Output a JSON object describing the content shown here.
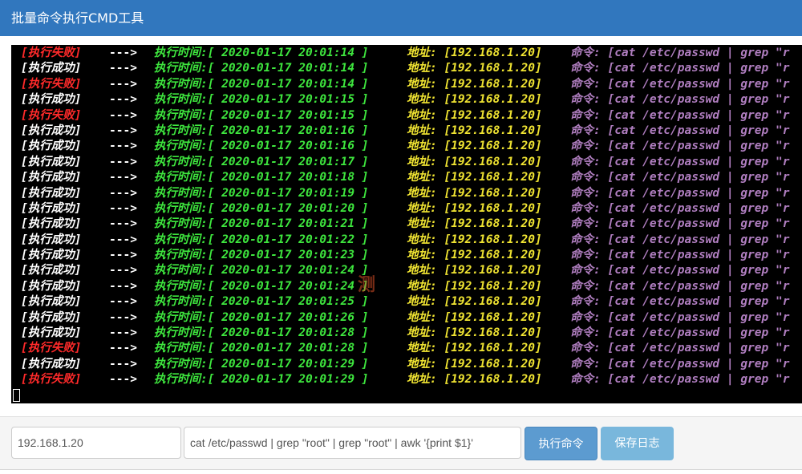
{
  "app": {
    "title": "批量命令执行CMD工具"
  },
  "colors": {
    "titlebar": "#3177be",
    "success": "#ffffff",
    "failure": "#ff2a2a",
    "time": "#3ee63e",
    "address": "#f0e432",
    "command": "#b07ec0"
  },
  "watermark": "测",
  "console": {
    "lines": [
      {
        "status": "[执行失败]",
        "ok": false,
        "arrow": "--->",
        "time": "执行时间:[ 2020-01-17 20:01:14 ]",
        "addr": "地址: [192.168.1.20]",
        "cmd": "命令: [cat /etc/passwd | grep \"r"
      },
      {
        "status": "[执行成功]",
        "ok": true,
        "arrow": "--->",
        "time": "执行时间:[ 2020-01-17 20:01:14 ]",
        "addr": "地址: [192.168.1.20]",
        "cmd": "命令: [cat /etc/passwd | grep \"r"
      },
      {
        "status": "[执行失败]",
        "ok": false,
        "arrow": "--->",
        "time": "执行时间:[ 2020-01-17 20:01:14 ]",
        "addr": "地址: [192.168.1.20]",
        "cmd": "命令: [cat /etc/passwd | grep \"r"
      },
      {
        "status": "[执行成功]",
        "ok": true,
        "arrow": "--->",
        "time": "执行时间:[ 2020-01-17 20:01:15 ]",
        "addr": "地址: [192.168.1.20]",
        "cmd": "命令: [cat /etc/passwd | grep \"r"
      },
      {
        "status": "[执行失败]",
        "ok": false,
        "arrow": "--->",
        "time": "执行时间:[ 2020-01-17 20:01:15 ]",
        "addr": "地址: [192.168.1.20]",
        "cmd": "命令: [cat /etc/passwd | grep \"r"
      },
      {
        "status": "[执行成功]",
        "ok": true,
        "arrow": "--->",
        "time": "执行时间:[ 2020-01-17 20:01:16 ]",
        "addr": "地址: [192.168.1.20]",
        "cmd": "命令: [cat /etc/passwd | grep \"r"
      },
      {
        "status": "[执行成功]",
        "ok": true,
        "arrow": "--->",
        "time": "执行时间:[ 2020-01-17 20:01:16 ]",
        "addr": "地址: [192.168.1.20]",
        "cmd": "命令: [cat /etc/passwd | grep \"r"
      },
      {
        "status": "[执行成功]",
        "ok": true,
        "arrow": "--->",
        "time": "执行时间:[ 2020-01-17 20:01:17 ]",
        "addr": "地址: [192.168.1.20]",
        "cmd": "命令: [cat /etc/passwd | grep \"r"
      },
      {
        "status": "[执行成功]",
        "ok": true,
        "arrow": "--->",
        "time": "执行时间:[ 2020-01-17 20:01:18 ]",
        "addr": "地址: [192.168.1.20]",
        "cmd": "命令: [cat /etc/passwd | grep \"r"
      },
      {
        "status": "[执行成功]",
        "ok": true,
        "arrow": "--->",
        "time": "执行时间:[ 2020-01-17 20:01:19 ]",
        "addr": "地址: [192.168.1.20]",
        "cmd": "命令: [cat /etc/passwd | grep \"r"
      },
      {
        "status": "[执行成功]",
        "ok": true,
        "arrow": "--->",
        "time": "执行时间:[ 2020-01-17 20:01:20 ]",
        "addr": "地址: [192.168.1.20]",
        "cmd": "命令: [cat /etc/passwd | grep \"r"
      },
      {
        "status": "[执行成功]",
        "ok": true,
        "arrow": "--->",
        "time": "执行时间:[ 2020-01-17 20:01:21 ]",
        "addr": "地址: [192.168.1.20]",
        "cmd": "命令: [cat /etc/passwd | grep \"r"
      },
      {
        "status": "[执行成功]",
        "ok": true,
        "arrow": "--->",
        "time": "执行时间:[ 2020-01-17 20:01:22 ]",
        "addr": "地址: [192.168.1.20]",
        "cmd": "命令: [cat /etc/passwd | grep \"r"
      },
      {
        "status": "[执行成功]",
        "ok": true,
        "arrow": "--->",
        "time": "执行时间:[ 2020-01-17 20:01:23 ]",
        "addr": "地址: [192.168.1.20]",
        "cmd": "命令: [cat /etc/passwd | grep \"r"
      },
      {
        "status": "[执行成功]",
        "ok": true,
        "arrow": "--->",
        "time": "执行时间:[ 2020-01-17 20:01:24 ]",
        "addr": "地址: [192.168.1.20]",
        "cmd": "命令: [cat /etc/passwd | grep \"r"
      },
      {
        "status": "[执行成功]",
        "ok": true,
        "arrow": "--->",
        "time": "执行时间:[ 2020-01-17 20:01:24 ]",
        "addr": "地址: [192.168.1.20]",
        "cmd": "命令: [cat /etc/passwd | grep \"r"
      },
      {
        "status": "[执行成功]",
        "ok": true,
        "arrow": "--->",
        "time": "执行时间:[ 2020-01-17 20:01:25 ]",
        "addr": "地址: [192.168.1.20]",
        "cmd": "命令: [cat /etc/passwd | grep \"r"
      },
      {
        "status": "[执行成功]",
        "ok": true,
        "arrow": "--->",
        "time": "执行时间:[ 2020-01-17 20:01:26 ]",
        "addr": "地址: [192.168.1.20]",
        "cmd": "命令: [cat /etc/passwd | grep \"r"
      },
      {
        "status": "[执行成功]",
        "ok": true,
        "arrow": "--->",
        "time": "执行时间:[ 2020-01-17 20:01:28 ]",
        "addr": "地址: [192.168.1.20]",
        "cmd": "命令: [cat /etc/passwd | grep \"r"
      },
      {
        "status": "[执行失败]",
        "ok": false,
        "arrow": "--->",
        "time": "执行时间:[ 2020-01-17 20:01:28 ]",
        "addr": "地址: [192.168.1.20]",
        "cmd": "命令: [cat /etc/passwd | grep \"r"
      },
      {
        "status": "[执行成功]",
        "ok": true,
        "arrow": "--->",
        "time": "执行时间:[ 2020-01-17 20:01:29 ]",
        "addr": "地址: [192.168.1.20]",
        "cmd": "命令: [cat /etc/passwd | grep \"r"
      },
      {
        "status": "[执行失败]",
        "ok": false,
        "arrow": "--->",
        "time": "执行时间:[ 2020-01-17 20:01:29 ]",
        "addr": "地址: [192.168.1.20]",
        "cmd": "命令: [cat /etc/passwd | grep \"r"
      }
    ]
  },
  "inputs": {
    "ip_value": "192.168.1.20",
    "command_value": "cat /etc/passwd | grep \"root\" | grep \"root\" | awk '{print $1}'"
  },
  "buttons": {
    "execute_label": "执行命令",
    "save_log_label": "保存日志"
  }
}
